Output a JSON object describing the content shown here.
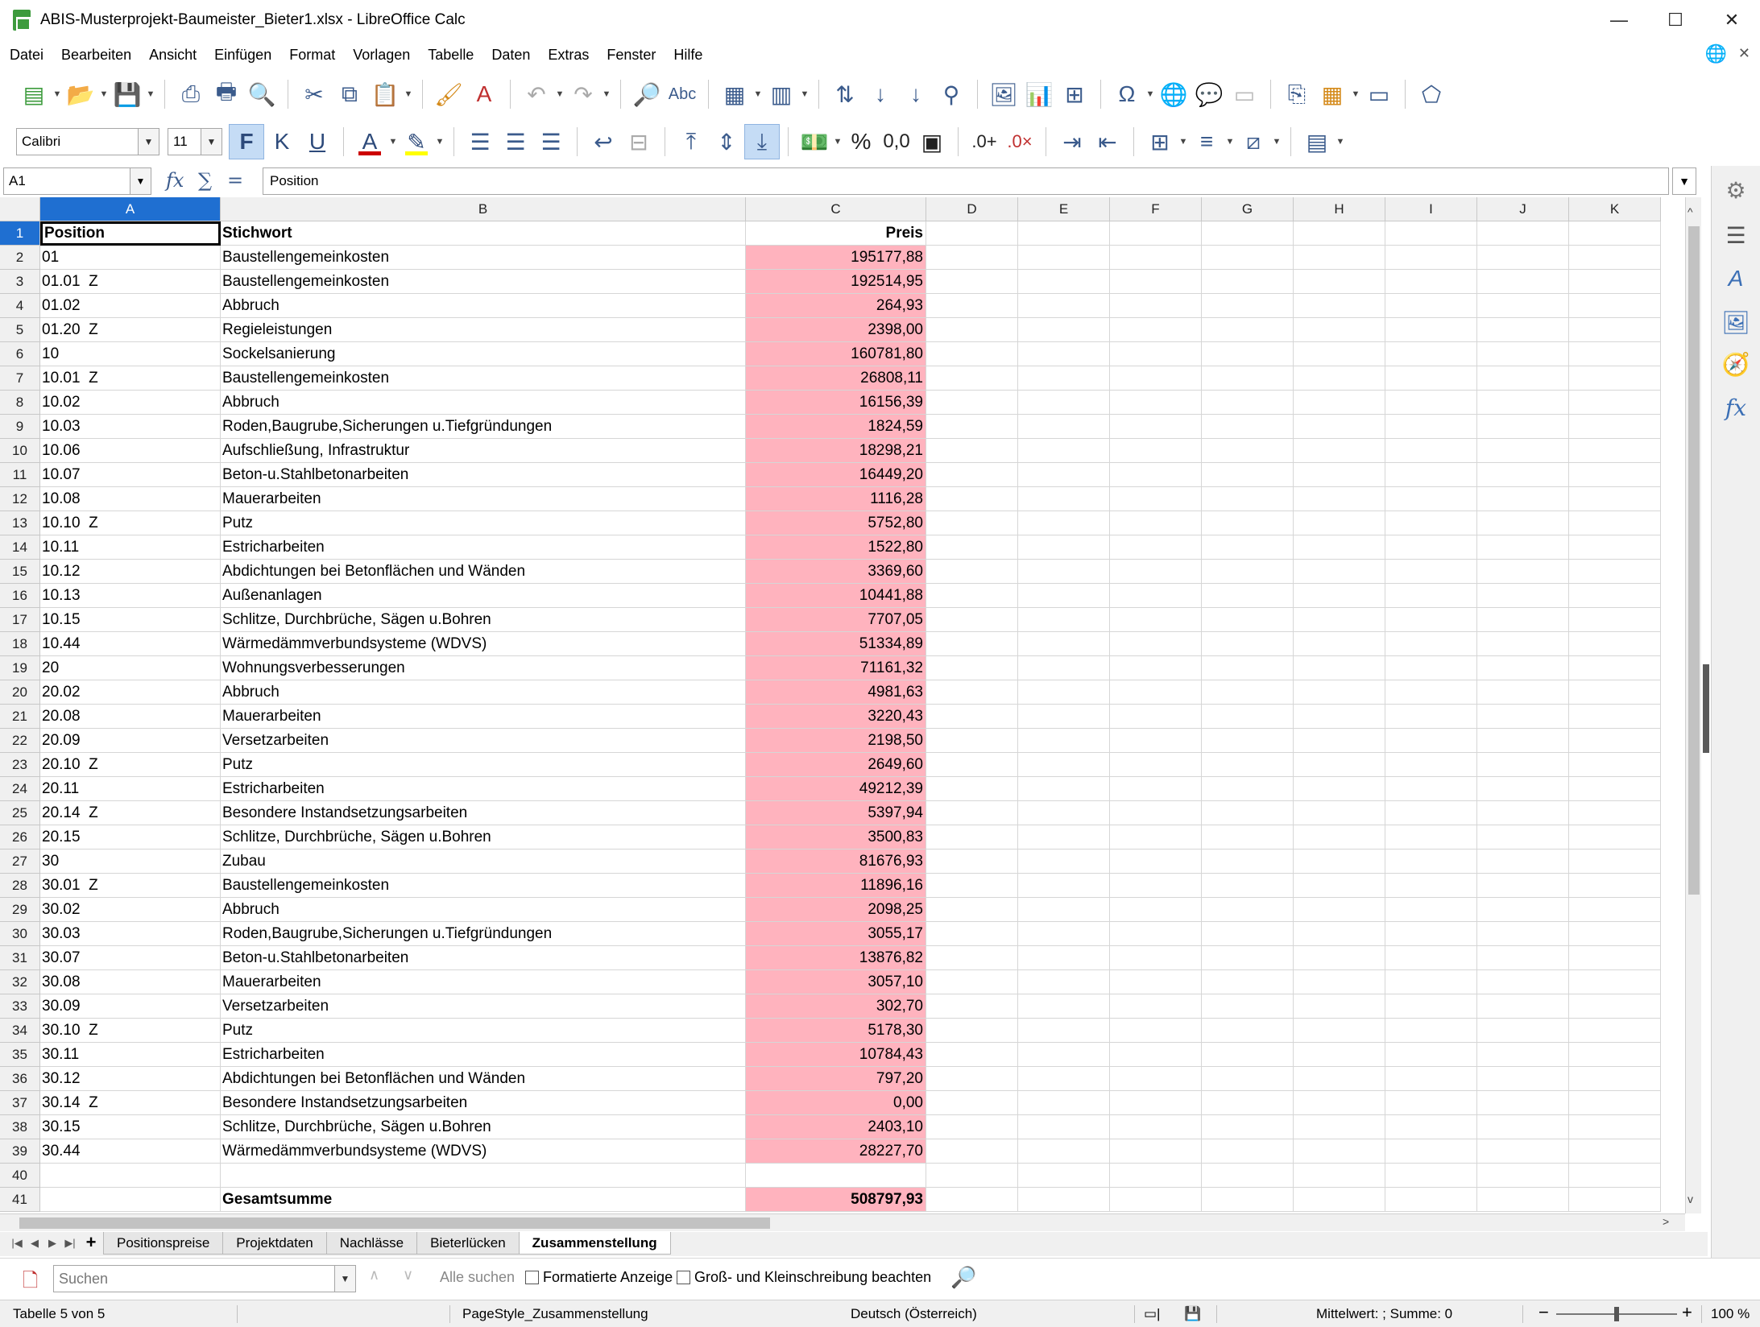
{
  "window": {
    "title": "ABIS-Musterprojekt-Baumeister_Bieter1.xlsx - LibreOffice Calc",
    "minimize": "—",
    "maximize": "☐",
    "close": "✕"
  },
  "menu": [
    "Datei",
    "Bearbeiten",
    "Ansicht",
    "Einfügen",
    "Format",
    "Vorlagen",
    "Tabelle",
    "Daten",
    "Extras",
    "Fenster",
    "Hilfe"
  ],
  "toolbar2": {
    "font_name": "Calibri",
    "font_size": "11",
    "bold": "F",
    "italic": "K",
    "underline": "U",
    "percent": "%",
    "number": "0,0",
    "font_color": "#cc0000",
    "highlight_color": "#ffff00"
  },
  "formula_bar": {
    "cell_ref": "A1",
    "content": "Position"
  },
  "columns": [
    "A",
    "B",
    "C",
    "D",
    "E",
    "F",
    "G",
    "H",
    "I",
    "J",
    "K"
  ],
  "header_row": {
    "position": "Position",
    "stichwort": "Stichwort",
    "preis": "Preis"
  },
  "rows": [
    {
      "pos": "01",
      "stich": "Baustellengemeinkosten",
      "preis": "195177,88"
    },
    {
      "pos": "01.01  Z",
      "stich": "Baustellengemeinkosten",
      "preis": "192514,95"
    },
    {
      "pos": "01.02",
      "stich": "Abbruch",
      "preis": "264,93"
    },
    {
      "pos": "01.20  Z",
      "stich": "Regieleistungen",
      "preis": "2398,00"
    },
    {
      "pos": "10",
      "stich": "Sockelsanierung",
      "preis": "160781,80"
    },
    {
      "pos": "10.01  Z",
      "stich": "Baustellengemeinkosten",
      "preis": "26808,11"
    },
    {
      "pos": "10.02",
      "stich": "Abbruch",
      "preis": "16156,39"
    },
    {
      "pos": "10.03",
      "stich": "Roden,Baugrube,Sicherungen u.Tiefgründungen",
      "preis": "1824,59"
    },
    {
      "pos": "10.06",
      "stich": "Aufschließung, Infrastruktur",
      "preis": "18298,21"
    },
    {
      "pos": "10.07",
      "stich": "Beton-u.Stahlbetonarbeiten",
      "preis": "16449,20"
    },
    {
      "pos": "10.08",
      "stich": "Mauerarbeiten",
      "preis": "1116,28"
    },
    {
      "pos": "10.10  Z",
      "stich": "Putz",
      "preis": "5752,80"
    },
    {
      "pos": "10.11",
      "stich": "Estricharbeiten",
      "preis": "1522,80"
    },
    {
      "pos": "10.12",
      "stich": "Abdichtungen bei Betonflächen und Wänden",
      "preis": "3369,60"
    },
    {
      "pos": "10.13",
      "stich": "Außenanlagen",
      "preis": "10441,88"
    },
    {
      "pos": "10.15",
      "stich": "Schlitze, Durchbrüche, Sägen u.Bohren",
      "preis": "7707,05"
    },
    {
      "pos": "10.44",
      "stich": "Wärmedämmverbundsysteme (WDVS)",
      "preis": "51334,89"
    },
    {
      "pos": "20",
      "stich": "Wohnungsverbesserungen",
      "preis": "71161,32"
    },
    {
      "pos": "20.02",
      "stich": "Abbruch",
      "preis": "4981,63"
    },
    {
      "pos": "20.08",
      "stich": "Mauerarbeiten",
      "preis": "3220,43"
    },
    {
      "pos": "20.09",
      "stich": "Versetzarbeiten",
      "preis": "2198,50"
    },
    {
      "pos": "20.10  Z",
      "stich": "Putz",
      "preis": "2649,60"
    },
    {
      "pos": "20.11",
      "stich": "Estricharbeiten",
      "preis": "49212,39"
    },
    {
      "pos": "20.14  Z",
      "stich": "Besondere Instandsetzungsarbeiten",
      "preis": "5397,94"
    },
    {
      "pos": "20.15",
      "stich": "Schlitze, Durchbrüche, Sägen u.Bohren",
      "preis": "3500,83"
    },
    {
      "pos": "30",
      "stich": "Zubau",
      "preis": "81676,93"
    },
    {
      "pos": "30.01  Z",
      "stich": "Baustellengemeinkosten",
      "preis": "11896,16"
    },
    {
      "pos": "30.02",
      "stich": "Abbruch",
      "preis": "2098,25"
    },
    {
      "pos": "30.03",
      "stich": "Roden,Baugrube,Sicherungen u.Tiefgründungen",
      "preis": "3055,17"
    },
    {
      "pos": "30.07",
      "stich": "Beton-u.Stahlbetonarbeiten",
      "preis": "13876,82"
    },
    {
      "pos": "30.08",
      "stich": "Mauerarbeiten",
      "preis": "3057,10"
    },
    {
      "pos": "30.09",
      "stich": "Versetzarbeiten",
      "preis": "302,70"
    },
    {
      "pos": "30.10  Z",
      "stich": "Putz",
      "preis": "5178,30"
    },
    {
      "pos": "30.11",
      "stich": "Estricharbeiten",
      "preis": "10784,43"
    },
    {
      "pos": "30.12",
      "stich": "Abdichtungen bei Betonflächen und Wänden",
      "preis": "797,20"
    },
    {
      "pos": "30.14  Z",
      "stich": "Besondere Instandsetzungsarbeiten",
      "preis": "0,00"
    },
    {
      "pos": "30.15",
      "stich": "Schlitze, Durchbrüche, Sägen u.Bohren",
      "preis": "2403,10"
    },
    {
      "pos": "30.44",
      "stich": "Wärmedämmverbundsysteme (WDVS)",
      "preis": "28227,70"
    },
    {
      "pos": "",
      "stich": "",
      "preis": ""
    },
    {
      "pos": "",
      "stich": "Gesamtsumme",
      "preis": "508797,93"
    }
  ],
  "sheet_tabs": [
    "Positionspreise",
    "Projektdaten",
    "Nachlässe",
    "Bieterlücken",
    "Zusammenstellung"
  ],
  "active_sheet": "Zusammenstellung",
  "find_bar": {
    "placeholder": "Suchen",
    "find_all": "Alle suchen",
    "formatted_display": "Formatierte Anzeige",
    "match_case": "Groß- und Kleinschreibung beachten"
  },
  "status_bar": {
    "sheet": "Tabelle 5 von 5",
    "page_style": "PageStyle_Zusammenstellung",
    "language": "Deutsch (Österreich)",
    "summary": "Mittelwert: ; Summe: 0",
    "zoom": "100 %",
    "zoom_level": 1.0
  },
  "colors": {
    "highlight_cell": "#ffb3be",
    "selection": "#1f6fd1"
  }
}
